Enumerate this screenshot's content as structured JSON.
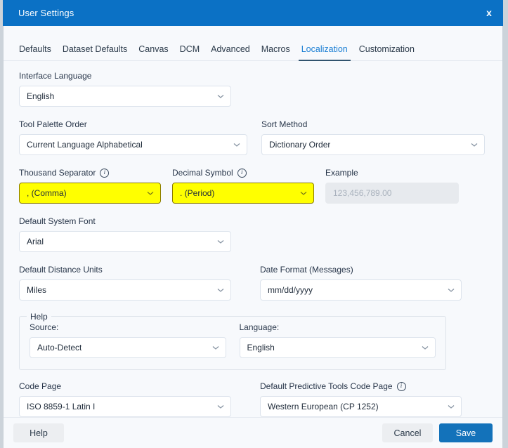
{
  "window": {
    "title": "User Settings",
    "close_label": "x",
    "accent_color": "#0b71c5",
    "highlight_color": "#ffff00",
    "primary_button_color": "#1372ba"
  },
  "tabs": [
    {
      "label": "Defaults",
      "active": false
    },
    {
      "label": "Dataset Defaults",
      "active": false
    },
    {
      "label": "Canvas",
      "active": false
    },
    {
      "label": "DCM",
      "active": false
    },
    {
      "label": "Advanced",
      "active": false
    },
    {
      "label": "Macros",
      "active": false
    },
    {
      "label": "Localization",
      "active": true
    },
    {
      "label": "Customization",
      "active": false
    }
  ],
  "form": {
    "interface_language": {
      "label": "Interface Language",
      "value": "English"
    },
    "tool_palette_order": {
      "label": "Tool Palette Order",
      "value": "Current Language Alphabetical"
    },
    "sort_method": {
      "label": "Sort Method",
      "value": "Dictionary Order"
    },
    "thousand_separator": {
      "label": "Thousand Separator",
      "value": ", (Comma)",
      "info": "i"
    },
    "decimal_symbol": {
      "label": "Decimal Symbol",
      "value": ". (Period)",
      "info": "i"
    },
    "example": {
      "label": "Example",
      "value": "123,456,789.00"
    },
    "default_system_font": {
      "label": "Default System Font",
      "value": "Arial"
    },
    "default_distance_units": {
      "label": "Default Distance Units",
      "value": "Miles"
    },
    "date_format": {
      "label": "Date Format (Messages)",
      "value": "mm/dd/yyyy"
    },
    "help_group": {
      "title": "Help",
      "source": {
        "label": "Source:",
        "value": "Auto-Detect"
      },
      "language": {
        "label": "Language:",
        "value": "English"
      }
    },
    "code_page": {
      "label": "Code Page",
      "value": "ISO 8859-1 Latin I"
    },
    "predictive_code_page": {
      "label": "Default Predictive Tools Code Page",
      "value": "Western European (CP 1252)",
      "info": "i"
    }
  },
  "footer": {
    "help": "Help",
    "cancel": "Cancel",
    "save": "Save"
  }
}
